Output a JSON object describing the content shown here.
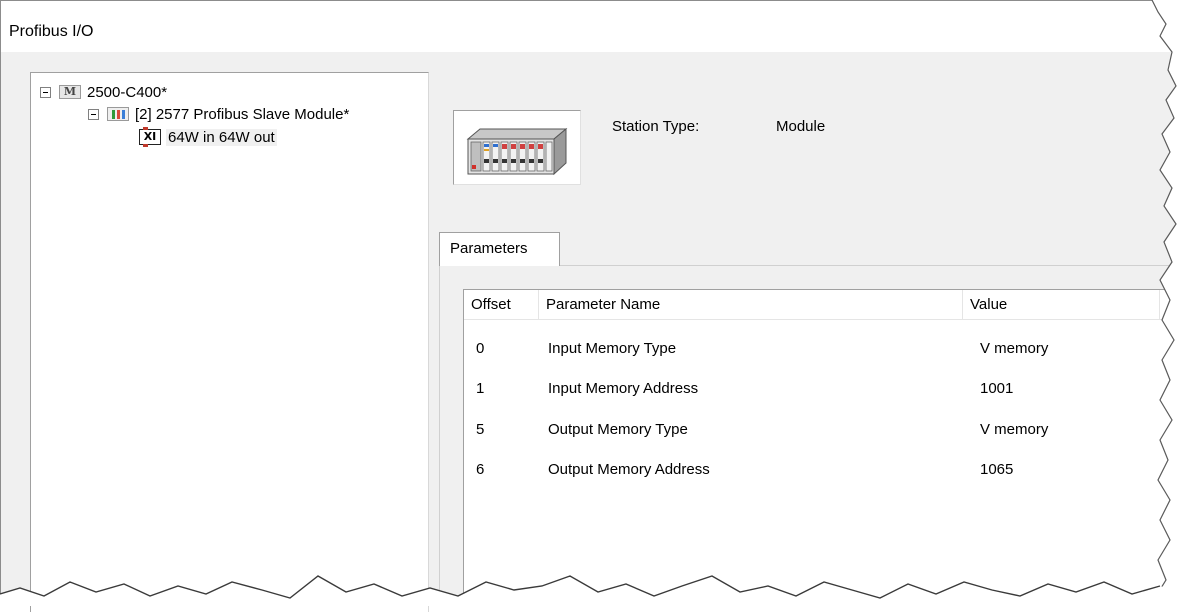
{
  "window": {
    "title": "Profibus I/O"
  },
  "tree": {
    "root": {
      "icon": "module-m-icon",
      "label": "2500-C400*"
    },
    "child": {
      "icon": "slave-module-icon",
      "label": "[2] 2577 Profibus Slave Module*"
    },
    "leaf": {
      "icon": "io-xi-icon",
      "icon_text": "XI",
      "label": "64W in 64W out"
    }
  },
  "station": {
    "type_label": "Station Type:",
    "type_value": "Module",
    "icon": "station-rack-icon"
  },
  "tabs": [
    {
      "label": "Parameters"
    }
  ],
  "table": {
    "columns": [
      "Offset",
      "Parameter Name",
      "Value"
    ],
    "rows": [
      {
        "offset": "0",
        "name": "Input Memory Type",
        "value": "V memory"
      },
      {
        "offset": "1",
        "name": "Input Memory Address",
        "value": "1001"
      },
      {
        "offset": "5",
        "name": "Output Memory Type",
        "value": "V memory"
      },
      {
        "offset": "6",
        "name": "Output Memory Address",
        "value": "1065"
      }
    ]
  }
}
